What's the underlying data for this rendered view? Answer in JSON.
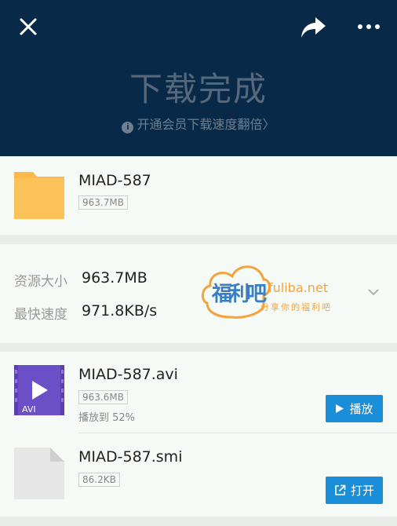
{
  "header": {
    "close_icon": "close-icon",
    "share_icon": "share-icon",
    "more_icon": "more-icon",
    "title": "下载完成",
    "info_icon": "i",
    "subtitle": "开通会员下载速度翻倍",
    "subtitle_arrow": "〉",
    "bg_color": "#082a48"
  },
  "folder": {
    "icon": "folder-icon",
    "name": "MIAD-587",
    "size": "963.7MB",
    "color": "#fbb94a"
  },
  "resource": {
    "size_label": "资源大小",
    "size_value": "963.7MB",
    "speed_label": "最快速度",
    "speed_value": "971.8KB/s",
    "expand_icon": "chevron-down-icon"
  },
  "watermark": {
    "logo_text": "福利吧",
    "site": "fuliba.net",
    "slogan": "分享你的福利吧"
  },
  "files": [
    {
      "name": "MIAD-587.avi",
      "type_label": "AVI",
      "size": "963.6MB",
      "progress": "播放到 52%",
      "action": "播放"
    },
    {
      "name": "MIAD-587.smi",
      "size": "86.2KB",
      "action": "打开"
    }
  ],
  "accent_color": "#1a8ed9"
}
